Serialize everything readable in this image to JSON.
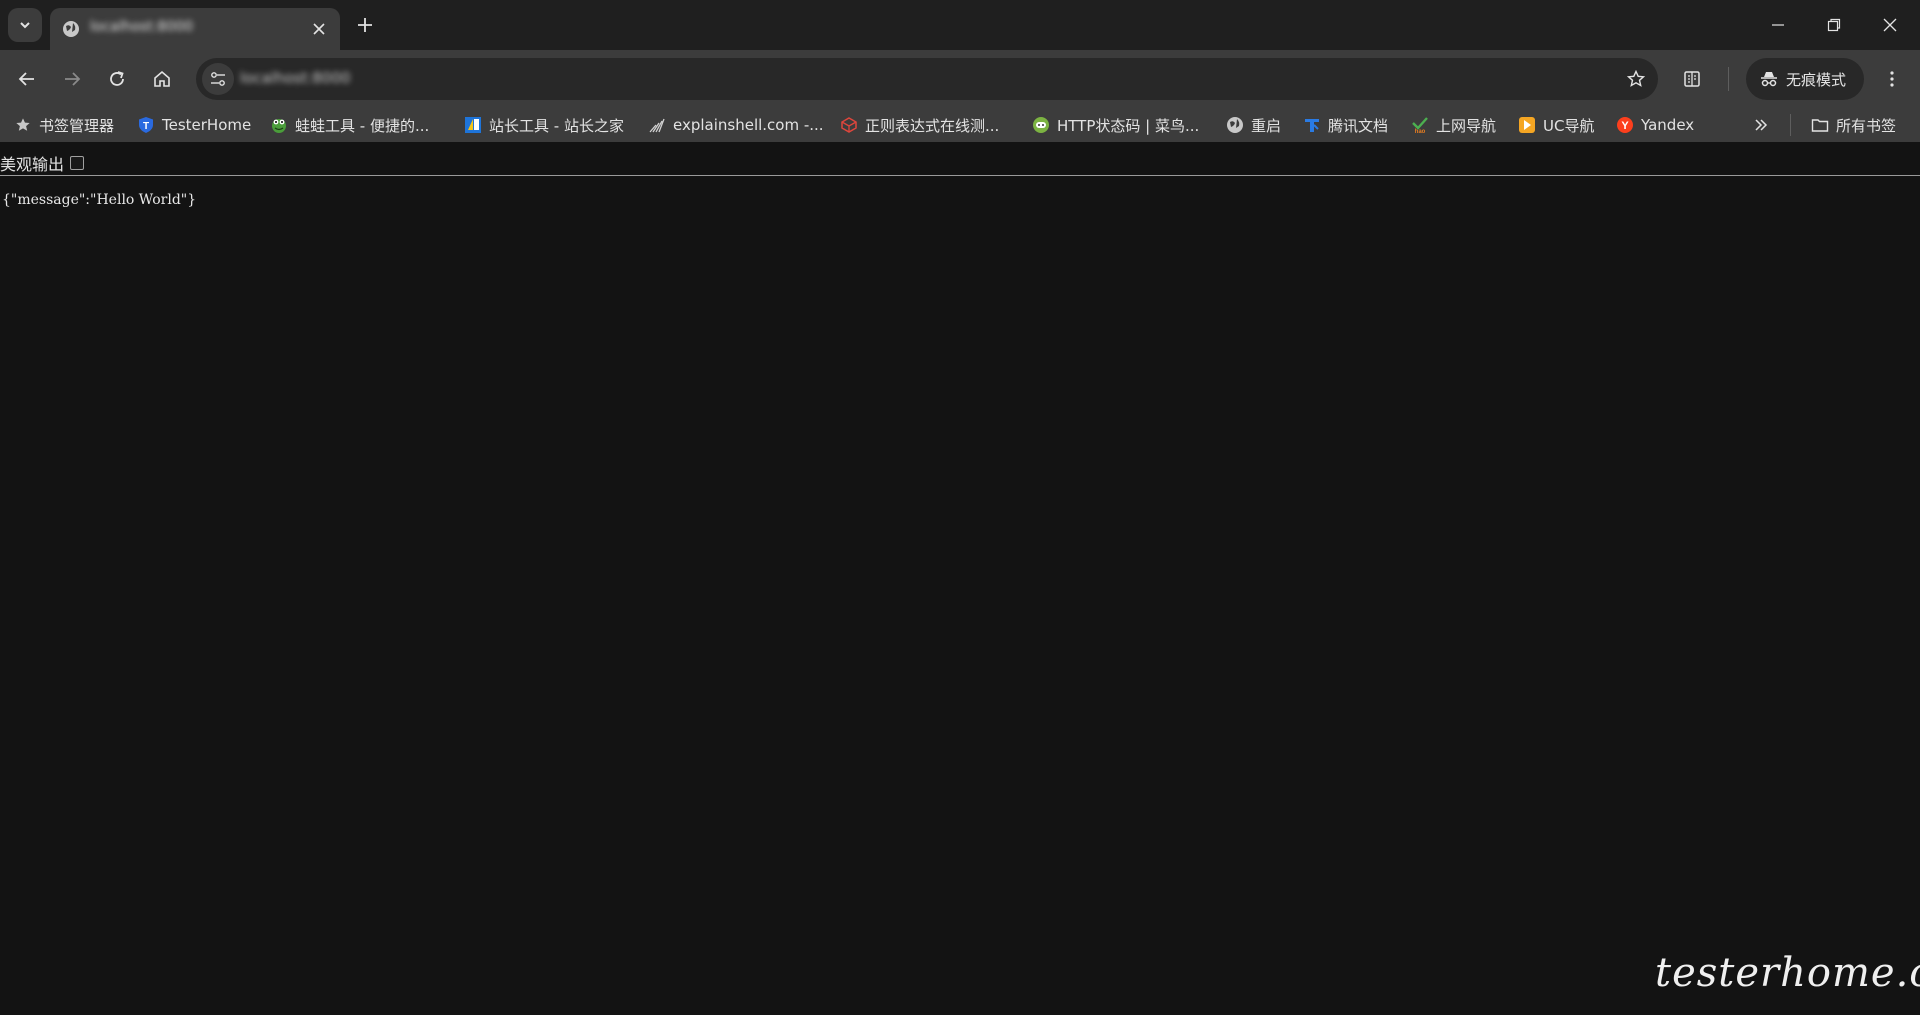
{
  "window": {
    "tab": {
      "title": "localhost:8000"
    }
  },
  "toolbar": {
    "url": "localhost:8000",
    "incognito_label": "无痕模式"
  },
  "bookmarks": {
    "items": [
      {
        "label": "书签管理器",
        "icon": "star-icon"
      },
      {
        "label": "TesterHome",
        "icon": "testerhome-icon"
      },
      {
        "label": "蛙蛙工具 - 便捷的...",
        "icon": "frog-icon"
      },
      {
        "label": "站长工具 - 站长之家",
        "icon": "chinaz-icon"
      },
      {
        "label": "explainshell.com -...",
        "icon": "shell-icon"
      },
      {
        "label": "正则表达式在线测...",
        "icon": "regex-icon"
      },
      {
        "label": "HTTP状态码 | 菜鸟...",
        "icon": "runoob-icon"
      },
      {
        "label": "重启",
        "icon": "globe-icon"
      },
      {
        "label": "腾讯文档",
        "icon": "tencent-docs-icon"
      },
      {
        "label": "上网导航",
        "icon": "hao-icon"
      },
      {
        "label": "UC导航",
        "icon": "uc-icon"
      },
      {
        "label": "Yandex",
        "icon": "yandex-icon"
      }
    ],
    "all_bookmarks_label": "所有书签"
  },
  "page": {
    "pretty_print_label": "美观输出",
    "json_text": "{\"message\":\"Hello World\"}"
  },
  "watermark": "testerhome.com",
  "colors": {
    "tabstrip": "#1f1f1f",
    "toolbar": "#3c3c3c",
    "omnibox": "#282828",
    "page_bg": "#131313"
  }
}
